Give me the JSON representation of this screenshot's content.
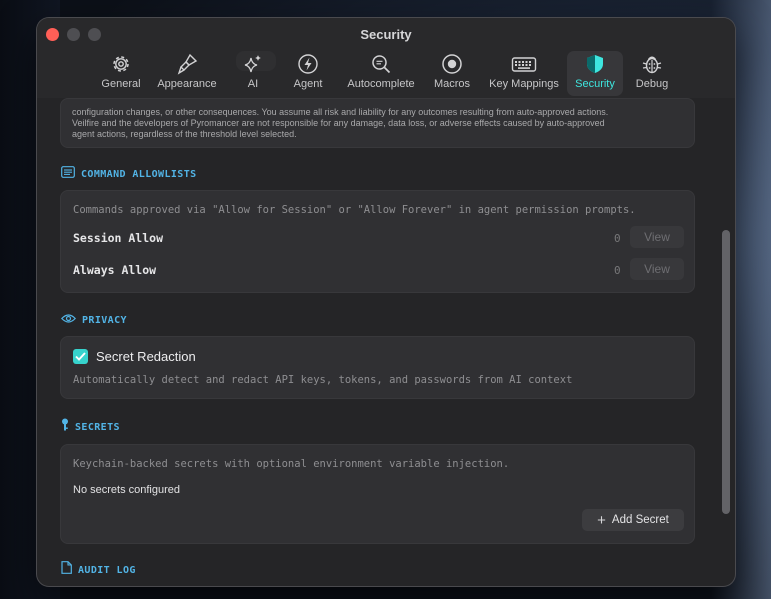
{
  "window": {
    "title": "Security"
  },
  "tabs": [
    {
      "label": "General",
      "icon": "gear-icon"
    },
    {
      "label": "Appearance",
      "icon": "paintbrush-icon"
    },
    {
      "label": "AI",
      "icon": "sparkles-icon"
    },
    {
      "label": "Agent",
      "icon": "bolt-icon"
    },
    {
      "label": "Autocomplete",
      "icon": "magnifier-icon"
    },
    {
      "label": "Macros",
      "icon": "record-icon"
    },
    {
      "label": "Key Mappings",
      "icon": "keyboard-icon"
    },
    {
      "label": "Security",
      "icon": "shield-icon",
      "active": true
    },
    {
      "label": "Debug",
      "icon": "bug-icon"
    }
  ],
  "colors": {
    "accent": "#3ee6df",
    "section_header": "#52b4e6",
    "close": "#ff5f57"
  },
  "warning": {
    "line1": "configuration changes, or other consequences. You assume all risk and liability for any outcomes resulting from auto-approved actions.",
    "line2": "Veilfire and the developers of Pyromancer are not responsible for any damage, data loss, or adverse effects caused by auto-approved",
    "line3": "agent actions, regardless of the threshold level selected."
  },
  "allowlists": {
    "header": "COMMAND ALLOWLISTS",
    "description": "Commands approved via \"Allow for Session\" or \"Allow Forever\" in agent permission prompts.",
    "session": {
      "label": "Session Allow",
      "count": "0",
      "button": "View"
    },
    "always": {
      "label": "Always Allow",
      "count": "0",
      "button": "View"
    }
  },
  "privacy": {
    "header": "PRIVACY",
    "redaction_label": "Secret Redaction",
    "redaction_checked": true,
    "description": "Automatically detect and redact API keys, tokens, and passwords from AI context"
  },
  "secrets": {
    "header": "SECRETS",
    "description": "Keychain-backed secrets with optional environment variable injection.",
    "empty_text": "No secrets configured",
    "add_button": "Add Secret"
  },
  "audit": {
    "header": "AUDIT LOG"
  }
}
